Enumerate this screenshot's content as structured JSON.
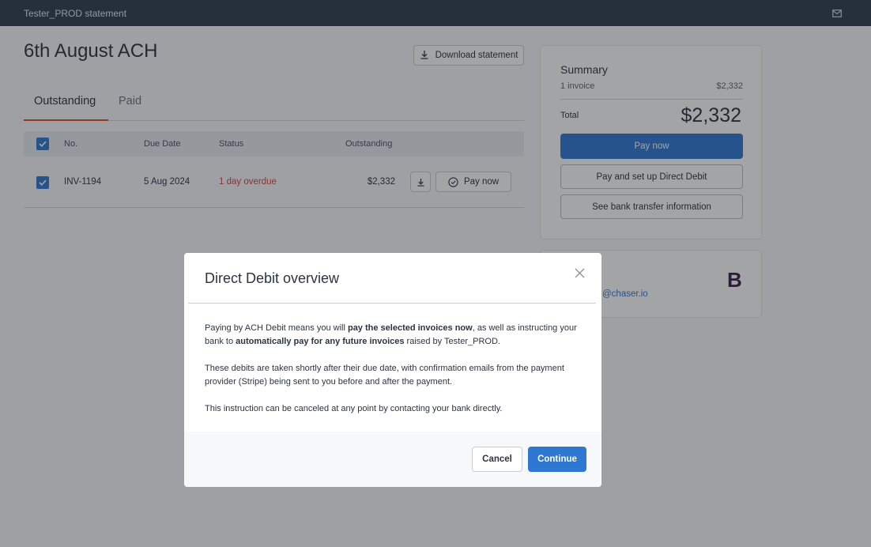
{
  "topbar": {
    "title": "Tester_PROD statement",
    "icon": "mail-icon"
  },
  "statement": {
    "title": "6th August ACH",
    "download_label": "Download statement"
  },
  "tabs": [
    {
      "label": "Outstanding",
      "active": true
    },
    {
      "label": "Paid",
      "active": false
    }
  ],
  "table": {
    "headers": {
      "no": "No.",
      "due_date": "Due Date",
      "status": "Status",
      "outstanding": "Outstanding"
    },
    "rows": [
      {
        "no": "INV-1194",
        "due_date": "5 Aug 2024",
        "status": "1 day overdue",
        "outstanding": "$2,332",
        "pay_label": "Pay now",
        "checked": true
      }
    ]
  },
  "summary": {
    "title": "Summary",
    "line_label": "1 invoice",
    "line_amount": "$2,332",
    "total_label": "Total",
    "total_amount": "$2,332",
    "pay_now_label": "Pay now",
    "direct_debit_label": "Pay and set up Direct Debit",
    "bank_transfer_label": "See bank transfer information"
  },
  "contact": {
    "email_visible": "@chaser.io",
    "logo_letter": "B"
  },
  "modal": {
    "title": "Direct Debit overview",
    "p1": {
      "t1": "Paying by ACH Debit means you will ",
      "b1": "pay the selected invoices now",
      "t2": ", as well as instructing your bank to ",
      "b2": "automatically pay for any future invoices",
      "t3": " raised by Tester_PROD."
    },
    "p2": "These debits are taken shortly after their due date, with confirmation emails from the payment provider (Stripe) being sent to you before and after the payment.",
    "p3": "This instruction can be canceled at any point by contacting your bank directly.",
    "cancel_label": "Cancel",
    "continue_label": "Continue"
  },
  "colors": {
    "topbar_bg": "#2f3d4f",
    "accent_blue": "#2f78d2",
    "tab_underline": "#e0502e",
    "overdue_red": "#d64545"
  }
}
